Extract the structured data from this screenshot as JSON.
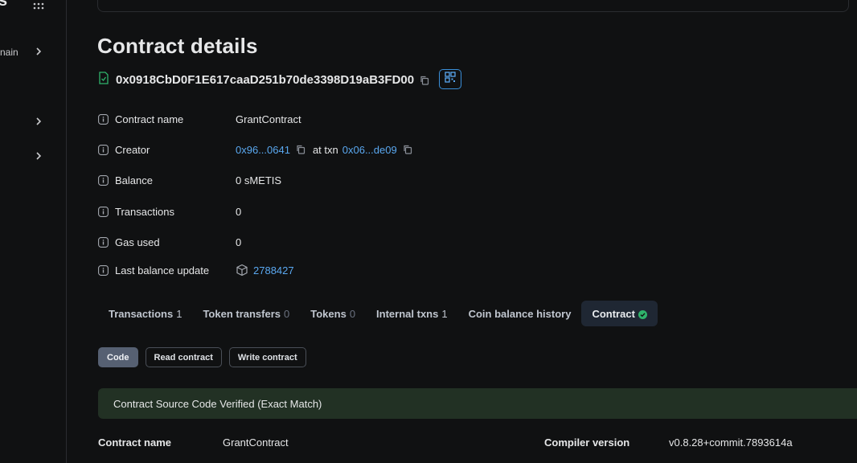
{
  "sidebar": {
    "logo_fragment": "s",
    "items": [
      {
        "label": "nain"
      },
      {
        "label": ""
      },
      {
        "label": ""
      }
    ]
  },
  "page": {
    "title": "Contract details",
    "address": "0x0918CbD0F1E617caaD251b70de3398D19aB3FD00"
  },
  "details": {
    "contract_name": {
      "label": "Contract name",
      "value": "GrantContract"
    },
    "creator": {
      "label": "Creator",
      "address": "0x96...0641",
      "at_txn": "at txn",
      "txn": "0x06...de09"
    },
    "balance": {
      "label": "Balance",
      "value": "0 sMETIS"
    },
    "transactions": {
      "label": "Transactions",
      "value": "0"
    },
    "gas_used": {
      "label": "Gas used",
      "value": "0"
    },
    "last_balance_update": {
      "label": "Last balance update",
      "value": "2788427"
    }
  },
  "tabs": [
    {
      "label": "Transactions",
      "count": "1"
    },
    {
      "label": "Token transfers",
      "count": "0"
    },
    {
      "label": "Tokens",
      "count": "0"
    },
    {
      "label": "Internal txns",
      "count": "1"
    },
    {
      "label": "Coin balance history",
      "count": ""
    },
    {
      "label": "Contract",
      "count": "",
      "active": true
    }
  ],
  "code_tabs": [
    "Code",
    "Read contract",
    "Write contract"
  ],
  "verified_banner": "Contract Source Code Verified (Exact Match)",
  "bottom": {
    "contract_name_label": "Contract name",
    "contract_name_value": "GrantContract",
    "compiler_label": "Compiler version",
    "compiler_value": "v0.8.28+commit.7893614a"
  },
  "colors": {
    "link": "#5aa8f0",
    "verified_bg": "#223124",
    "check": "#2fb36b"
  }
}
